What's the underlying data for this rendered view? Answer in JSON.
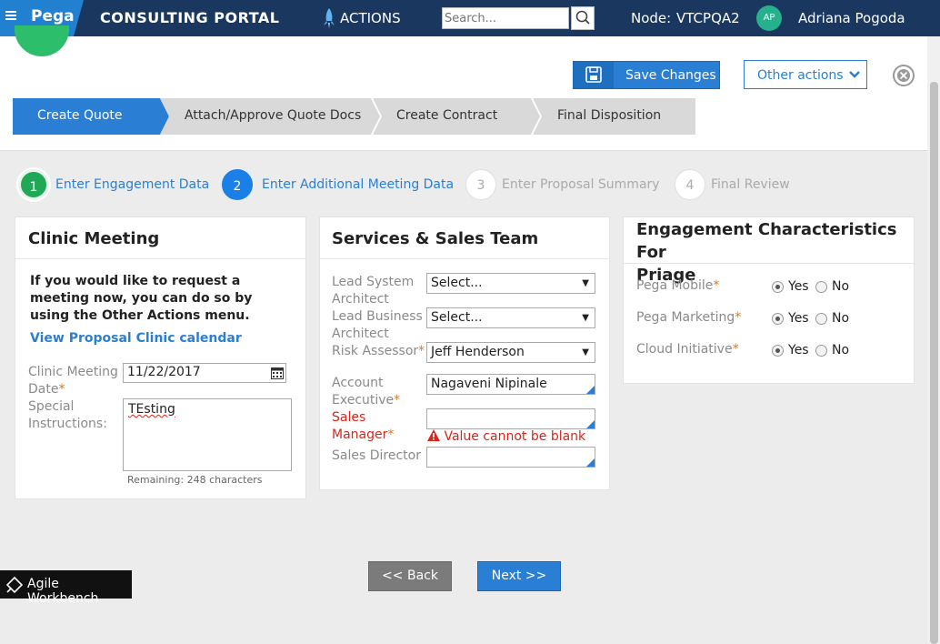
{
  "topbar": {
    "brand": "Pega",
    "portal_title": "CONSULTING PORTAL",
    "actions_label": "ACTIONS",
    "search_placeholder": "Search...",
    "node_label": "Node:",
    "node_value": "VTCPQA2",
    "avatar_initials": "AP",
    "user_name": "Adriana Pogoda"
  },
  "header": {
    "save_label": "Save Changes",
    "other_actions_label": "Other actions"
  },
  "stages": [
    {
      "label": "Create Quote",
      "active": true
    },
    {
      "label": "Attach/Approve Quote Docs",
      "active": false
    },
    {
      "label": "Create Contract",
      "active": false
    },
    {
      "label": "Final Disposition",
      "active": false
    }
  ],
  "steps": [
    {
      "num": "1",
      "label": "Enter Engagement Data",
      "state": "done"
    },
    {
      "num": "2",
      "label": "Enter Additional Meeting Data",
      "state": "current"
    },
    {
      "num": "3",
      "label": "Enter Proposal Summary",
      "state": "future"
    },
    {
      "num": "4",
      "label": "Final Review",
      "state": "future"
    }
  ],
  "clinic": {
    "title": "Clinic Meeting",
    "intro": "If you would like to request a meeting now, you can do so by using the Other Actions menu.",
    "calendar_link": "View Proposal Clinic calendar",
    "date_label_1": "Clinic Meeting",
    "date_label_2": "Date",
    "date_value": "11/22/2017",
    "instructions_label_1": "Special",
    "instructions_label_2": "Instructions:",
    "instructions_value": "TEsting",
    "remaining": "Remaining: 248 characters"
  },
  "services": {
    "title": "Services & Sales Team",
    "lsa_label_1": "Lead System",
    "lsa_label_2": "Architect",
    "lsa_value": "Select...",
    "lba_label_1": "Lead Business",
    "lba_label_2": "Architect",
    "lba_value": "Select...",
    "risk_label": "Risk Assessor",
    "risk_value": "Jeff Henderson",
    "ae_label_1": "Account",
    "ae_label_2": "Executive",
    "ae_value": "Nagaveni Nipinale",
    "sm_label_1": "Sales",
    "sm_label_2": "Manager",
    "sm_value": "",
    "sm_error": "Value cannot be blank",
    "sd_label": "Sales Director",
    "sd_value": ""
  },
  "engagement": {
    "title_1": "Engagement Characteristics For",
    "title_2": "Priage",
    "rows": [
      {
        "label": "Pega Mobile",
        "yes": "Yes",
        "no": "No",
        "selected": "yes"
      },
      {
        "label": "Pega Marketing",
        "yes": "Yes",
        "no": "No",
        "selected": "yes"
      },
      {
        "label": "Cloud Initiative",
        "yes": "Yes",
        "no": "No",
        "selected": "yes"
      }
    ]
  },
  "nav": {
    "back_label": "<< Back",
    "next_label": "Next >>"
  },
  "workbench_label": "Agile Workbench",
  "required_mark": "*",
  "colors": {
    "topbar": "#1a3760",
    "brand": "#2280d0",
    "accent": "#2a7fd4",
    "done_step": "#1fa855",
    "error": "#d8261c",
    "required": "#e07a17"
  }
}
